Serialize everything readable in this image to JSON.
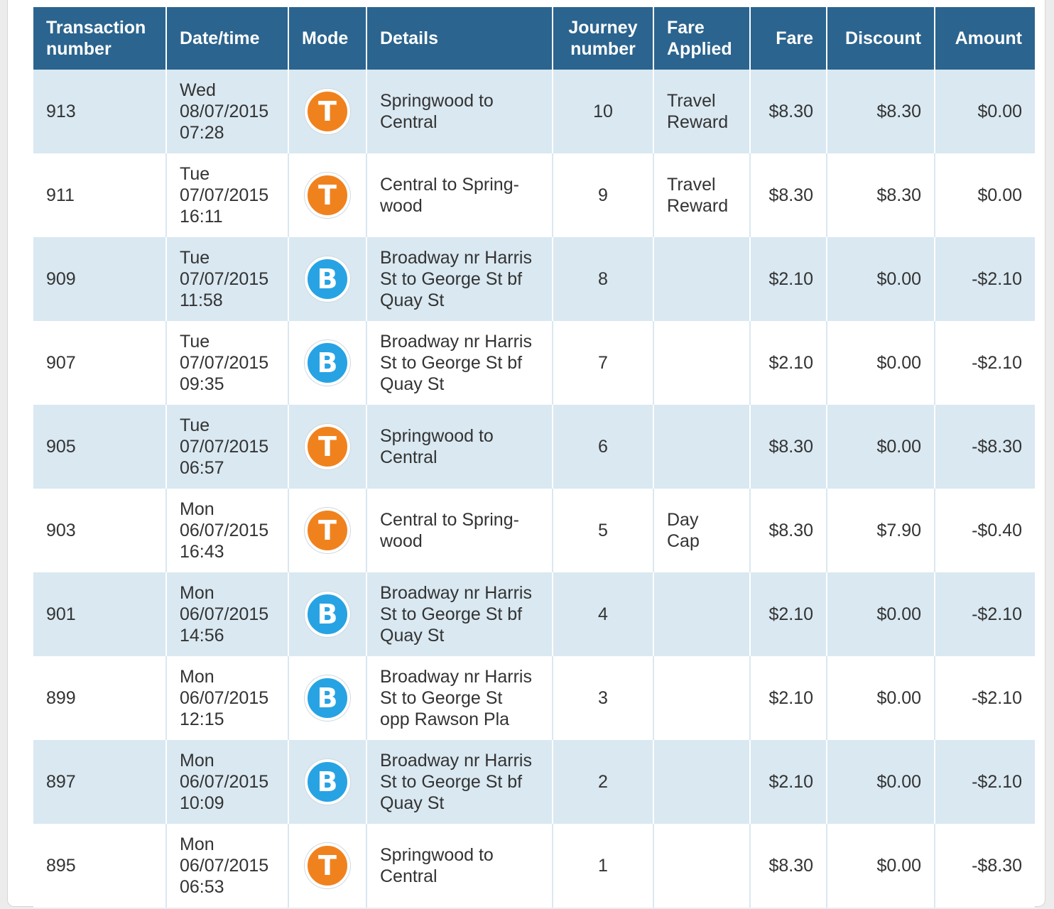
{
  "table": {
    "headers": {
      "transaction_line1": "Transaction",
      "transaction_line2": "number",
      "datetime": "Date/time",
      "mode": "Mode",
      "details": "Details",
      "journey_line1": "Journey",
      "journey_line2": "number",
      "fare_applied_line1": "Fare",
      "fare_applied_line2": "Applied",
      "fare": "Fare",
      "discount": "Discount",
      "amount": "Amount"
    },
    "rows": [
      {
        "txn": "913",
        "day": "Wed",
        "date": "08/07/2015",
        "time": "07:28",
        "mode": "train",
        "mode_letter": "T",
        "details": [
          "Springwood to",
          "Central"
        ],
        "journey": "10",
        "fare_applied": [
          "Travel",
          "Reward"
        ],
        "fare": "$8.30",
        "discount": "$8.30",
        "amount": "$0.00"
      },
      {
        "txn": "911",
        "day": "Tue",
        "date": "07/07/2015",
        "time": "16:11",
        "mode": "train",
        "mode_letter": "T",
        "details": [
          "Central to Spring-",
          "wood"
        ],
        "journey": "9",
        "fare_applied": [
          "Travel",
          "Reward"
        ],
        "fare": "$8.30",
        "discount": "$8.30",
        "amount": "$0.00"
      },
      {
        "txn": "909",
        "day": "Tue",
        "date": "07/07/2015",
        "time": "11:58",
        "mode": "bus",
        "mode_letter": "B",
        "details": [
          "Broadway nr Harris",
          "St to George St bf",
          "Quay St"
        ],
        "journey": "8",
        "fare_applied": [],
        "fare": "$2.10",
        "discount": "$0.00",
        "amount": "-$2.10"
      },
      {
        "txn": "907",
        "day": "Tue",
        "date": "07/07/2015",
        "time": "09:35",
        "mode": "bus",
        "mode_letter": "B",
        "details": [
          "Broadway nr Harris",
          "St to George St bf",
          "Quay St"
        ],
        "journey": "7",
        "fare_applied": [],
        "fare": "$2.10",
        "discount": "$0.00",
        "amount": "-$2.10"
      },
      {
        "txn": "905",
        "day": "Tue",
        "date": "07/07/2015",
        "time": "06:57",
        "mode": "train",
        "mode_letter": "T",
        "details": [
          "Springwood to",
          "Central"
        ],
        "journey": "6",
        "fare_applied": [],
        "fare": "$8.30",
        "discount": "$0.00",
        "amount": "-$8.30"
      },
      {
        "txn": "903",
        "day": "Mon",
        "date": "06/07/2015",
        "time": "16:43",
        "mode": "train",
        "mode_letter": "T",
        "details": [
          "Central to Spring-",
          "wood"
        ],
        "journey": "5",
        "fare_applied": [
          "Day",
          "Cap"
        ],
        "fare": "$8.30",
        "discount": "$7.90",
        "amount": "-$0.40"
      },
      {
        "txn": "901",
        "day": "Mon",
        "date": "06/07/2015",
        "time": "14:56",
        "mode": "bus",
        "mode_letter": "B",
        "details": [
          "Broadway nr Harris",
          "St to George St bf",
          "Quay St"
        ],
        "journey": "4",
        "fare_applied": [],
        "fare": "$2.10",
        "discount": "$0.00",
        "amount": "-$2.10"
      },
      {
        "txn": "899",
        "day": "Mon",
        "date": "06/07/2015",
        "time": "12:15",
        "mode": "bus",
        "mode_letter": "B",
        "details": [
          "Broadway nr Harris",
          "St to George St",
          "opp Rawson Pla"
        ],
        "journey": "3",
        "fare_applied": [],
        "fare": "$2.10",
        "discount": "$0.00",
        "amount": "-$2.10"
      },
      {
        "txn": "897",
        "day": "Mon",
        "date": "06/07/2015",
        "time": "10:09",
        "mode": "bus",
        "mode_letter": "B",
        "details": [
          "Broadway nr Harris",
          "St to George St bf",
          "Quay St"
        ],
        "journey": "2",
        "fare_applied": [],
        "fare": "$2.10",
        "discount": "$0.00",
        "amount": "-$2.10"
      },
      {
        "txn": "895",
        "day": "Mon",
        "date": "06/07/2015",
        "time": "06:53",
        "mode": "train",
        "mode_letter": "T",
        "details": [
          "Springwood to",
          "Central"
        ],
        "journey": "1",
        "fare_applied": [],
        "fare": "$8.30",
        "discount": "$0.00",
        "amount": "-$8.30"
      }
    ]
  },
  "colors": {
    "header_bg": "#2b648e",
    "row_stripe": "#d9e8f1",
    "train_icon": "#f0821e",
    "bus_icon": "#27a3e4"
  }
}
